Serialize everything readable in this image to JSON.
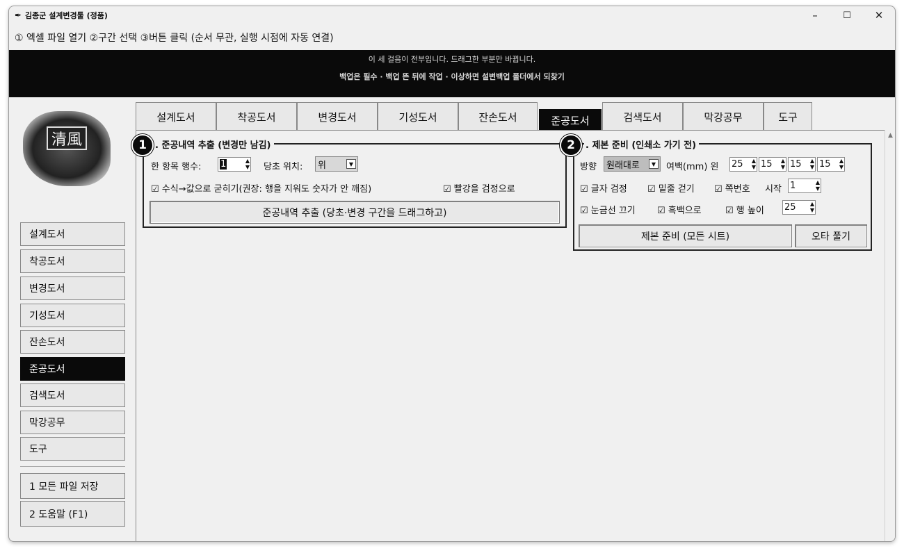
{
  "window": {
    "title": "김종군 설계변경툴 (정품)",
    "minimize": "–",
    "maximize": "☐",
    "close": "✕"
  },
  "instructions": "① 엑셀 파일 열기  ②구간 선택  ③버튼 클릭 (순서 무관, 실행 시점에 자동 연결)",
  "banner": {
    "line1": "이 세 걸음이 전부입니다. 드래그한 부분만 바뀝니다.",
    "line2": "백업은 필수 · 백업 뜬 뒤에 작업 · 이상하면 설변백업 폴더에서 되찾기"
  },
  "logo": {
    "text": "清風"
  },
  "sidebar": {
    "items": [
      "설계도서",
      "착공도서",
      "변경도서",
      "기성도서",
      "잔손도서",
      "준공도서",
      "검색도서",
      "막강공무",
      "도구"
    ],
    "active": "준공도서",
    "actions": [
      "1 모든 파일 저장",
      "2 도움말 (F1)"
    ]
  },
  "tabs": {
    "items": [
      "설계도서",
      "착공도서",
      "변경도서",
      "기성도서",
      "잔손도서",
      "준공도서",
      "검색도서",
      "막강공무",
      "도구"
    ],
    "active": "준공도서"
  },
  "section1": {
    "badge": "1",
    "title": ". 준공내역 추출 (변경만 남김)",
    "rows_label": "한 항목 행수:",
    "rows_value": "1",
    "pos_label": "당초 위치:",
    "pos_value": "위",
    "check_formula": "수식→값으로 굳히기(권장: 행을 지워도 숫자가 안 깨짐)",
    "check_red": "빨강을 검정으로",
    "button": "준공내역 추출 (당초·변경 구간을 드래그하고)"
  },
  "section2": {
    "badge": "2",
    "title": ". 제본 준비 (인쇄소 가기 전)",
    "dir_label": "방향",
    "dir_value": "원래대로",
    "margin_label": "여백(mm) 왼",
    "margins": [
      "25",
      "15",
      "15",
      "15"
    ],
    "check_font": "글자 검정",
    "check_underline": "밑줄 걷기",
    "check_pageno": "쪽번호",
    "start_label": "시작",
    "start_value": "1",
    "check_grid": "눈금선 끄기",
    "check_bw": "흑백으로",
    "check_rowh": "행 높이",
    "rowh_value": "25",
    "button_bind": "제본 준비 (모든 시트)",
    "button_typo": "오타 풀기"
  },
  "check_mark": "☑",
  "colors": {
    "accent": "#0a0a0a",
    "background": "#f0f0f0",
    "button": "#e8e8e8"
  }
}
